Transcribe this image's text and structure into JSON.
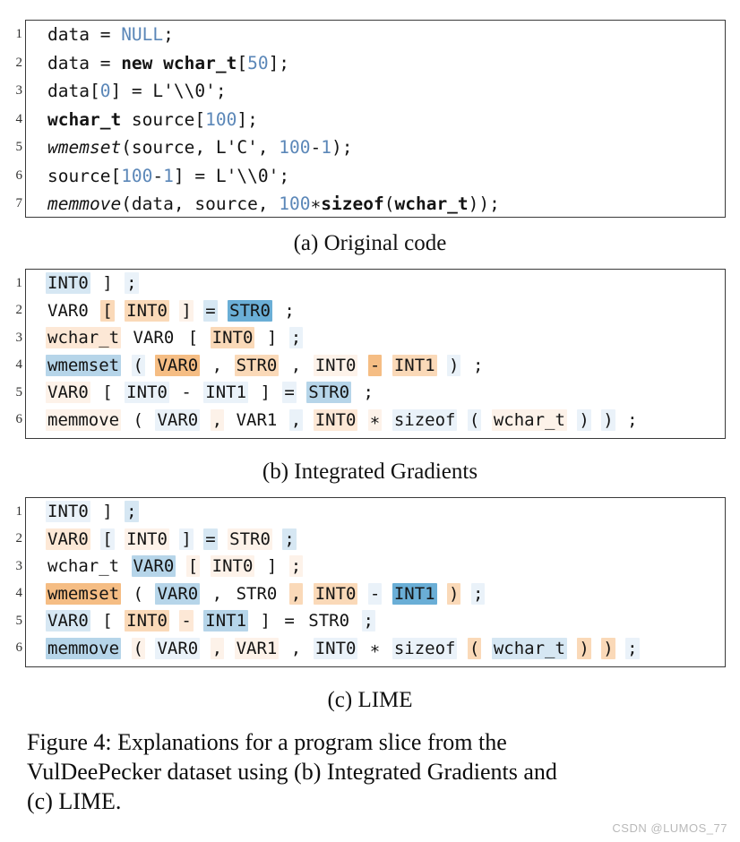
{
  "figure": {
    "caption_lines": [
      "Figure 4: Explanations for a program slice from the",
      "VulDeePecker dataset using (b) Integrated Gradients and",
      "(c) LIME."
    ],
    "watermark": "CSDN @LUMOS_77"
  },
  "colors": {
    "blue_strong": "#6aaed6",
    "blue_mid": "#b6d5e9",
    "blue_light": "#d6e7f3",
    "blue_faint": "#eaf2f9",
    "orange_strong": "#f5bd84",
    "orange_mid": "#fad9b8",
    "orange_light": "#fde8d6",
    "orange_faint": "#fdf2e9",
    "none": "#ffffff",
    "code_number": "#5b87b8",
    "code_text": "#141414",
    "border": "#3a3a3a"
  },
  "panel_a": {
    "label": "(a) Original code",
    "lines": [
      {
        "n": "1",
        "parts": [
          {
            "t": "data = ",
            "s": "plain"
          },
          {
            "t": "NULL",
            "s": "num"
          },
          {
            "t": ";",
            "s": "plain"
          }
        ]
      },
      {
        "n": "2",
        "parts": [
          {
            "t": "data = ",
            "s": "plain"
          },
          {
            "t": "new wchar_t",
            "s": "bold"
          },
          {
            "t": "[",
            "s": "plain"
          },
          {
            "t": "50",
            "s": "num"
          },
          {
            "t": "];",
            "s": "plain"
          }
        ]
      },
      {
        "n": "3",
        "parts": [
          {
            "t": "data[",
            "s": "plain"
          },
          {
            "t": "0",
            "s": "num"
          },
          {
            "t": "] = L'\\\\0';",
            "s": "plain"
          }
        ]
      },
      {
        "n": "4",
        "parts": [
          {
            "t": "wchar_t",
            "s": "bold"
          },
          {
            "t": " source[",
            "s": "plain"
          },
          {
            "t": "100",
            "s": "num"
          },
          {
            "t": "];",
            "s": "plain"
          }
        ]
      },
      {
        "n": "5",
        "parts": [
          {
            "t": "wmemset",
            "s": "ital"
          },
          {
            "t": "(source, L'C', ",
            "s": "plain"
          },
          {
            "t": "100",
            "s": "num"
          },
          {
            "t": "-",
            "s": "plain"
          },
          {
            "t": "1",
            "s": "num"
          },
          {
            "t": ");",
            "s": "plain"
          }
        ]
      },
      {
        "n": "6",
        "parts": [
          {
            "t": "source[",
            "s": "plain"
          },
          {
            "t": "100",
            "s": "num"
          },
          {
            "t": "-",
            "s": "plain"
          },
          {
            "t": "1",
            "s": "num"
          },
          {
            "t": "] = L'\\\\0';",
            "s": "plain"
          }
        ]
      },
      {
        "n": "7",
        "parts": [
          {
            "t": "memmove",
            "s": "ital"
          },
          {
            "t": "(data, source, ",
            "s": "plain"
          },
          {
            "t": "100",
            "s": "num"
          },
          {
            "t": "∗",
            "s": "plain"
          },
          {
            "t": "sizeof",
            "s": "bold"
          },
          {
            "t": "(",
            "s": "plain"
          },
          {
            "t": "wchar_t",
            "s": "bold"
          },
          {
            "t": "));",
            "s": "plain"
          }
        ]
      }
    ]
  },
  "panel_b": {
    "label": "(b) Integrated Gradients",
    "lines": [
      {
        "n": "1",
        "tokens": [
          {
            "t": "INT0",
            "h": "blue_light"
          },
          {
            "t": "]",
            "h": "none"
          },
          {
            "t": ";",
            "h": "blue_faint"
          }
        ]
      },
      {
        "n": "2",
        "tokens": [
          {
            "t": "VAR0",
            "h": "none"
          },
          {
            "t": "[",
            "h": "orange_mid"
          },
          {
            "t": "INT0",
            "h": "orange_mid"
          },
          {
            "t": "]",
            "h": "orange_faint"
          },
          {
            "t": "=",
            "h": "blue_light"
          },
          {
            "t": "STR0",
            "h": "blue_strong"
          },
          {
            "t": ";",
            "h": "none"
          }
        ]
      },
      {
        "n": "3",
        "tokens": [
          {
            "t": "wchar_t",
            "h": "orange_light"
          },
          {
            "t": "VAR0",
            "h": "none"
          },
          {
            "t": "[",
            "h": "none"
          },
          {
            "t": "INT0",
            "h": "orange_mid"
          },
          {
            "t": "]",
            "h": "none"
          },
          {
            "t": ";",
            "h": "blue_faint"
          }
        ]
      },
      {
        "n": "4",
        "tokens": [
          {
            "t": "wmemset",
            "h": "blue_mid"
          },
          {
            "t": "(",
            "h": "blue_faint"
          },
          {
            "t": "VAR0",
            "h": "orange_strong"
          },
          {
            "t": ",",
            "h": "none"
          },
          {
            "t": "STR0",
            "h": "orange_mid"
          },
          {
            "t": ",",
            "h": "none"
          },
          {
            "t": "INT0",
            "h": "orange_faint"
          },
          {
            "t": "-",
            "h": "orange_strong"
          },
          {
            "t": "INT1",
            "h": "orange_mid"
          },
          {
            "t": ")",
            "h": "blue_faint"
          },
          {
            "t": ";",
            "h": "none"
          }
        ]
      },
      {
        "n": "5",
        "tokens": [
          {
            "t": "VAR0",
            "h": "orange_faint"
          },
          {
            "t": "[",
            "h": "none"
          },
          {
            "t": "INT0",
            "h": "blue_faint"
          },
          {
            "t": "-",
            "h": "none"
          },
          {
            "t": "INT1",
            "h": "blue_faint"
          },
          {
            "t": "]",
            "h": "none"
          },
          {
            "t": "=",
            "h": "blue_faint"
          },
          {
            "t": "STR0",
            "h": "blue_mid"
          },
          {
            "t": ";",
            "h": "none"
          }
        ]
      },
      {
        "n": "6",
        "tokens": [
          {
            "t": "memmove",
            "h": "orange_faint"
          },
          {
            "t": "(",
            "h": "none"
          },
          {
            "t": "VAR0",
            "h": "blue_faint"
          },
          {
            "t": ",",
            "h": "orange_faint"
          },
          {
            "t": "VAR1",
            "h": "none"
          },
          {
            "t": ",",
            "h": "blue_faint"
          },
          {
            "t": "INT0",
            "h": "orange_light"
          },
          {
            "t": "∗",
            "h": "orange_faint"
          },
          {
            "t": "sizeof",
            "h": "blue_faint"
          },
          {
            "t": "(",
            "h": "blue_faint"
          },
          {
            "t": "wchar_t",
            "h": "orange_faint"
          },
          {
            "t": ")",
            "h": "blue_faint"
          },
          {
            "t": ")",
            "h": "blue_faint"
          },
          {
            "t": ";",
            "h": "none"
          }
        ]
      }
    ]
  },
  "panel_c": {
    "label": "(c) LIME",
    "lines": [
      {
        "n": "1",
        "tokens": [
          {
            "t": "INT0",
            "h": "blue_faint"
          },
          {
            "t": "]",
            "h": "none"
          },
          {
            "t": ";",
            "h": "blue_light"
          }
        ]
      },
      {
        "n": "2",
        "tokens": [
          {
            "t": "VAR0",
            "h": "orange_light"
          },
          {
            "t": "[",
            "h": "blue_faint"
          },
          {
            "t": "INT0",
            "h": "orange_faint"
          },
          {
            "t": "]",
            "h": "blue_faint"
          },
          {
            "t": "=",
            "h": "blue_light"
          },
          {
            "t": "STR0",
            "h": "orange_faint"
          },
          {
            "t": ";",
            "h": "blue_light"
          }
        ]
      },
      {
        "n": "3",
        "tokens": [
          {
            "t": "wchar_t",
            "h": "none"
          },
          {
            "t": "VAR0",
            "h": "blue_mid"
          },
          {
            "t": "[",
            "h": "orange_faint"
          },
          {
            "t": "INT0",
            "h": "orange_faint"
          },
          {
            "t": "]",
            "h": "none"
          },
          {
            "t": ";",
            "h": "orange_faint"
          }
        ]
      },
      {
        "n": "4",
        "tokens": [
          {
            "t": "wmemset",
            "h": "orange_strong"
          },
          {
            "t": "(",
            "h": "none"
          },
          {
            "t": "VAR0",
            "h": "blue_mid"
          },
          {
            "t": ",",
            "h": "none"
          },
          {
            "t": "STR0",
            "h": "none"
          },
          {
            "t": ",",
            "h": "orange_mid"
          },
          {
            "t": "INT0",
            "h": "orange_mid"
          },
          {
            "t": "-",
            "h": "blue_faint"
          },
          {
            "t": "INT1",
            "h": "blue_strong"
          },
          {
            "t": ")",
            "h": "orange_mid"
          },
          {
            "t": ";",
            "h": "blue_faint"
          }
        ]
      },
      {
        "n": "5",
        "tokens": [
          {
            "t": "VAR0",
            "h": "blue_light"
          },
          {
            "t": "[",
            "h": "none"
          },
          {
            "t": "INT0",
            "h": "orange_mid"
          },
          {
            "t": "-",
            "h": "orange_light"
          },
          {
            "t": "INT1",
            "h": "blue_mid"
          },
          {
            "t": "]",
            "h": "none"
          },
          {
            "t": "=",
            "h": "none"
          },
          {
            "t": "STR0",
            "h": "none"
          },
          {
            "t": ";",
            "h": "blue_faint"
          }
        ]
      },
      {
        "n": "6",
        "tokens": [
          {
            "t": "memmove",
            "h": "blue_mid"
          },
          {
            "t": "(",
            "h": "orange_faint"
          },
          {
            "t": "VAR0",
            "h": "blue_faint"
          },
          {
            "t": ",",
            "h": "orange_faint"
          },
          {
            "t": "VAR1",
            "h": "orange_faint"
          },
          {
            "t": ",",
            "h": "none"
          },
          {
            "t": "INT0",
            "h": "blue_faint"
          },
          {
            "t": "∗",
            "h": "none"
          },
          {
            "t": "sizeof",
            "h": "blue_faint"
          },
          {
            "t": "(",
            "h": "orange_mid"
          },
          {
            "t": "wchar_t",
            "h": "blue_light"
          },
          {
            "t": ")",
            "h": "orange_mid"
          },
          {
            "t": ")",
            "h": "orange_mid"
          },
          {
            "t": ";",
            "h": "blue_faint"
          }
        ]
      }
    ]
  }
}
